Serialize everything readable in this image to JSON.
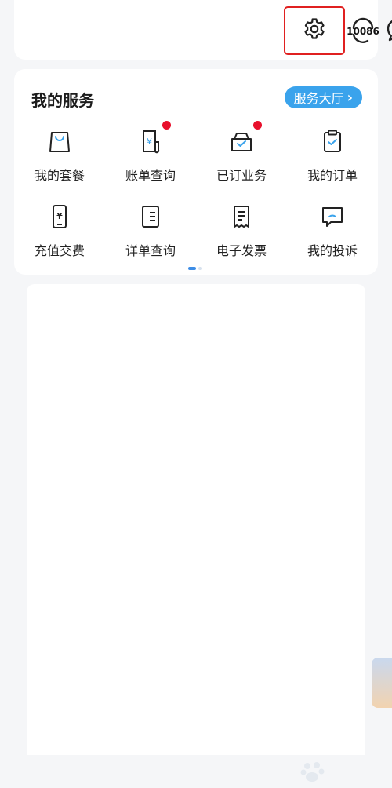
{
  "header": {
    "settings_icon": "gear-icon",
    "hotline_label": "10086",
    "message_icon": "chat-bubble-icon"
  },
  "services": {
    "title": "我的服务",
    "hall_button_label": "服务大厅",
    "hall_button_arrow": "›",
    "items": [
      {
        "label": "我的套餐",
        "icon": "shopping-bag-icon",
        "badge": false
      },
      {
        "label": "账单查询",
        "icon": "bill-icon",
        "badge": true
      },
      {
        "label": "已订业务",
        "icon": "subscribed-box-icon",
        "badge": true
      },
      {
        "label": "我的订单",
        "icon": "clipboard-check-icon",
        "badge": false
      },
      {
        "label": "充值交费",
        "icon": "phone-yuan-icon",
        "badge": false
      },
      {
        "label": "详单查询",
        "icon": "list-document-icon",
        "badge": false
      },
      {
        "label": "电子发票",
        "icon": "receipt-icon",
        "badge": false
      },
      {
        "label": "我的投诉",
        "icon": "complaint-message-icon",
        "badge": false
      }
    ],
    "pager": {
      "pages": 2,
      "current": 1
    }
  },
  "colors": {
    "accent": "#3aa3ec",
    "badge": "#e8102c",
    "highlight_box": "#e02020"
  }
}
